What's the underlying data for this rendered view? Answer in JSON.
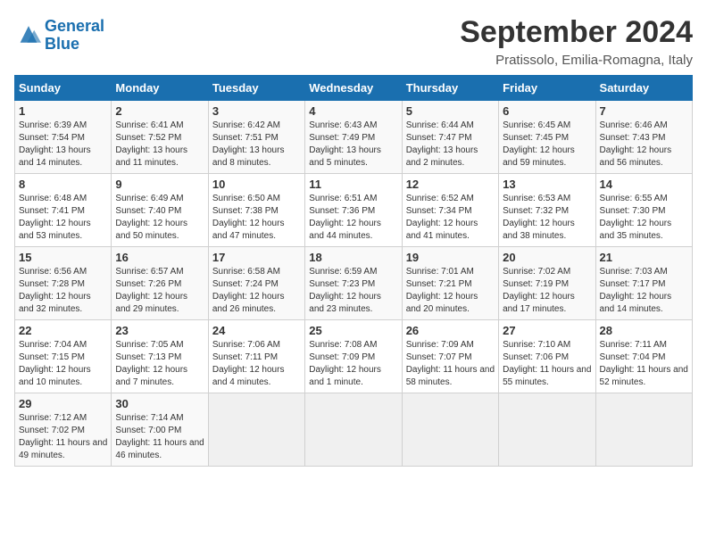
{
  "logo": {
    "line1": "General",
    "line2": "Blue"
  },
  "title": "September 2024",
  "location": "Pratissolo, Emilia-Romagna, Italy",
  "weekdays": [
    "Sunday",
    "Monday",
    "Tuesday",
    "Wednesday",
    "Thursday",
    "Friday",
    "Saturday"
  ],
  "weeks": [
    [
      {
        "day": "1",
        "info": "Sunrise: 6:39 AM\nSunset: 7:54 PM\nDaylight: 13 hours and 14 minutes."
      },
      {
        "day": "2",
        "info": "Sunrise: 6:41 AM\nSunset: 7:52 PM\nDaylight: 13 hours and 11 minutes."
      },
      {
        "day": "3",
        "info": "Sunrise: 6:42 AM\nSunset: 7:51 PM\nDaylight: 13 hours and 8 minutes."
      },
      {
        "day": "4",
        "info": "Sunrise: 6:43 AM\nSunset: 7:49 PM\nDaylight: 13 hours and 5 minutes."
      },
      {
        "day": "5",
        "info": "Sunrise: 6:44 AM\nSunset: 7:47 PM\nDaylight: 13 hours and 2 minutes."
      },
      {
        "day": "6",
        "info": "Sunrise: 6:45 AM\nSunset: 7:45 PM\nDaylight: 12 hours and 59 minutes."
      },
      {
        "day": "7",
        "info": "Sunrise: 6:46 AM\nSunset: 7:43 PM\nDaylight: 12 hours and 56 minutes."
      }
    ],
    [
      {
        "day": "8",
        "info": "Sunrise: 6:48 AM\nSunset: 7:41 PM\nDaylight: 12 hours and 53 minutes."
      },
      {
        "day": "9",
        "info": "Sunrise: 6:49 AM\nSunset: 7:40 PM\nDaylight: 12 hours and 50 minutes."
      },
      {
        "day": "10",
        "info": "Sunrise: 6:50 AM\nSunset: 7:38 PM\nDaylight: 12 hours and 47 minutes."
      },
      {
        "day": "11",
        "info": "Sunrise: 6:51 AM\nSunset: 7:36 PM\nDaylight: 12 hours and 44 minutes."
      },
      {
        "day": "12",
        "info": "Sunrise: 6:52 AM\nSunset: 7:34 PM\nDaylight: 12 hours and 41 minutes."
      },
      {
        "day": "13",
        "info": "Sunrise: 6:53 AM\nSunset: 7:32 PM\nDaylight: 12 hours and 38 minutes."
      },
      {
        "day": "14",
        "info": "Sunrise: 6:55 AM\nSunset: 7:30 PM\nDaylight: 12 hours and 35 minutes."
      }
    ],
    [
      {
        "day": "15",
        "info": "Sunrise: 6:56 AM\nSunset: 7:28 PM\nDaylight: 12 hours and 32 minutes."
      },
      {
        "day": "16",
        "info": "Sunrise: 6:57 AM\nSunset: 7:26 PM\nDaylight: 12 hours and 29 minutes."
      },
      {
        "day": "17",
        "info": "Sunrise: 6:58 AM\nSunset: 7:24 PM\nDaylight: 12 hours and 26 minutes."
      },
      {
        "day": "18",
        "info": "Sunrise: 6:59 AM\nSunset: 7:23 PM\nDaylight: 12 hours and 23 minutes."
      },
      {
        "day": "19",
        "info": "Sunrise: 7:01 AM\nSunset: 7:21 PM\nDaylight: 12 hours and 20 minutes."
      },
      {
        "day": "20",
        "info": "Sunrise: 7:02 AM\nSunset: 7:19 PM\nDaylight: 12 hours and 17 minutes."
      },
      {
        "day": "21",
        "info": "Sunrise: 7:03 AM\nSunset: 7:17 PM\nDaylight: 12 hours and 14 minutes."
      }
    ],
    [
      {
        "day": "22",
        "info": "Sunrise: 7:04 AM\nSunset: 7:15 PM\nDaylight: 12 hours and 10 minutes."
      },
      {
        "day": "23",
        "info": "Sunrise: 7:05 AM\nSunset: 7:13 PM\nDaylight: 12 hours and 7 minutes."
      },
      {
        "day": "24",
        "info": "Sunrise: 7:06 AM\nSunset: 7:11 PM\nDaylight: 12 hours and 4 minutes."
      },
      {
        "day": "25",
        "info": "Sunrise: 7:08 AM\nSunset: 7:09 PM\nDaylight: 12 hours and 1 minute."
      },
      {
        "day": "26",
        "info": "Sunrise: 7:09 AM\nSunset: 7:07 PM\nDaylight: 11 hours and 58 minutes."
      },
      {
        "day": "27",
        "info": "Sunrise: 7:10 AM\nSunset: 7:06 PM\nDaylight: 11 hours and 55 minutes."
      },
      {
        "day": "28",
        "info": "Sunrise: 7:11 AM\nSunset: 7:04 PM\nDaylight: 11 hours and 52 minutes."
      }
    ],
    [
      {
        "day": "29",
        "info": "Sunrise: 7:12 AM\nSunset: 7:02 PM\nDaylight: 11 hours and 49 minutes."
      },
      {
        "day": "30",
        "info": "Sunrise: 7:14 AM\nSunset: 7:00 PM\nDaylight: 11 hours and 46 minutes."
      },
      {
        "day": "",
        "info": ""
      },
      {
        "day": "",
        "info": ""
      },
      {
        "day": "",
        "info": ""
      },
      {
        "day": "",
        "info": ""
      },
      {
        "day": "",
        "info": ""
      }
    ]
  ]
}
